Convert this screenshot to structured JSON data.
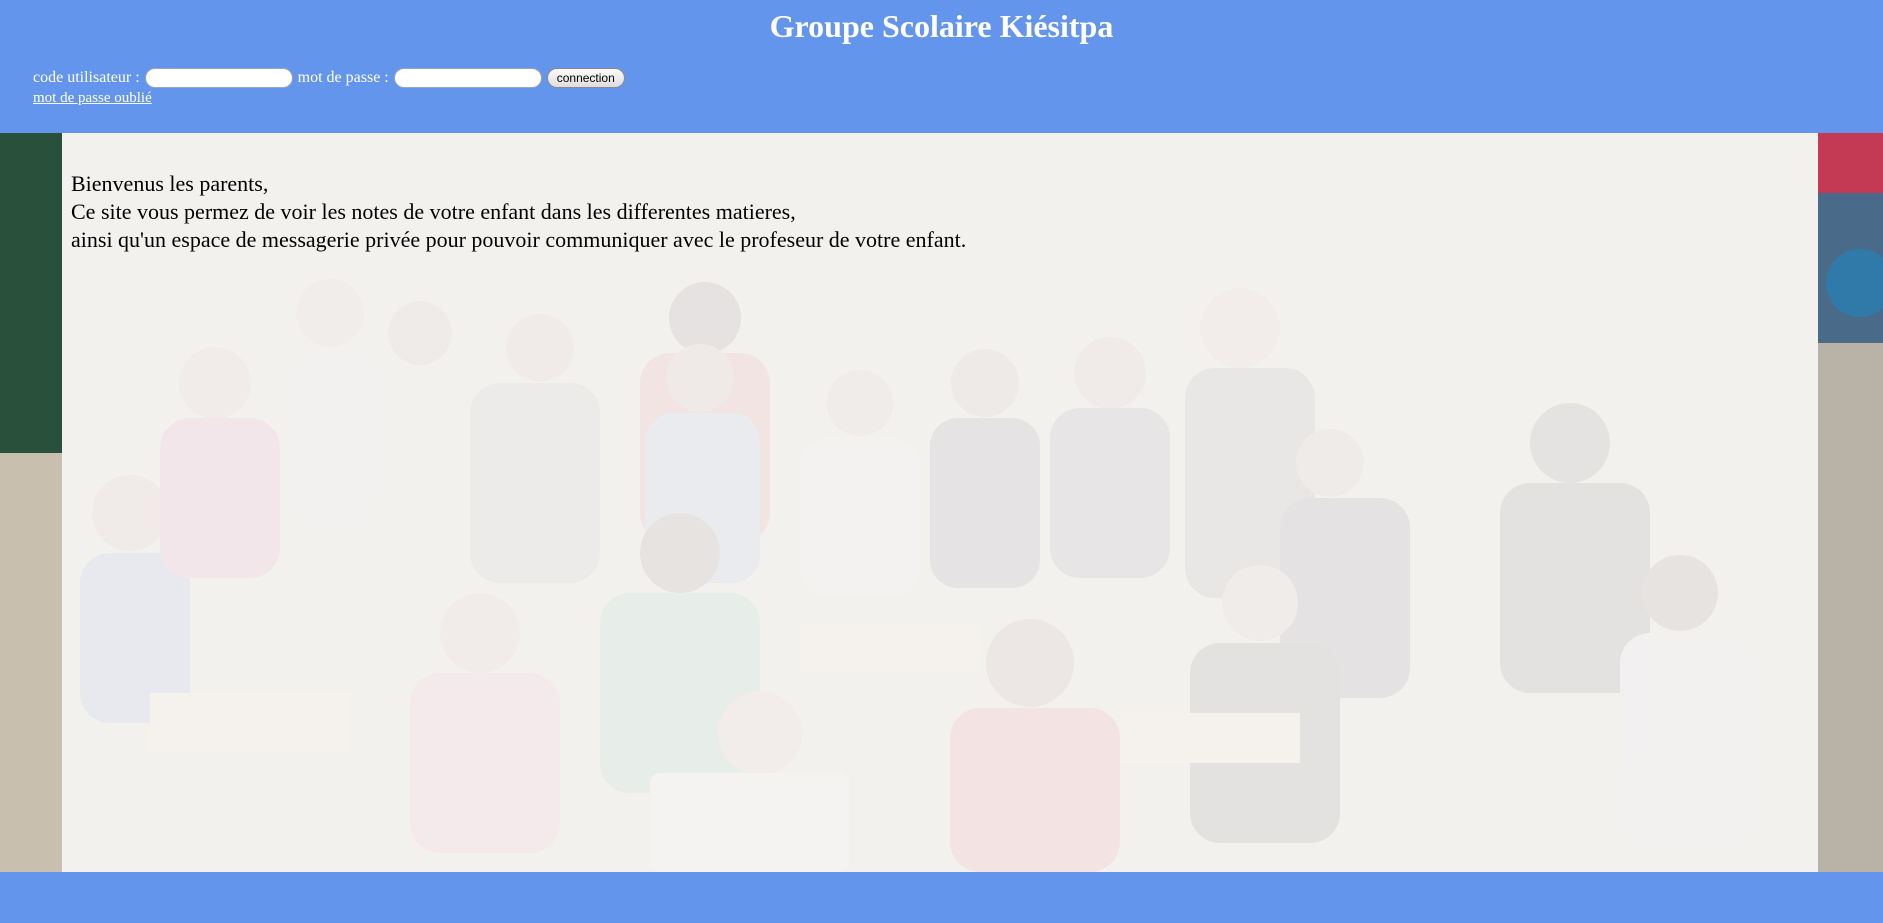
{
  "header": {
    "title": "Groupe Scolaire Kiésitpa",
    "background_color": "#6495ed"
  },
  "login": {
    "user_label": "code utilisateur :",
    "user_value": "",
    "password_label": "mot de passe :",
    "password_value": "",
    "connect_button": "connection",
    "forgot_link": "mot de passe oublié"
  },
  "main": {
    "background": "classroom-photo",
    "lines": [
      "Bienvenus les parents,",
      "Ce site vous permez de voir les notes de votre enfant dans les differentes matieres,",
      "ainsi qu'un espace de messagerie privée pour pouvoir communiquer avec le profeseur de votre enfant."
    ]
  }
}
